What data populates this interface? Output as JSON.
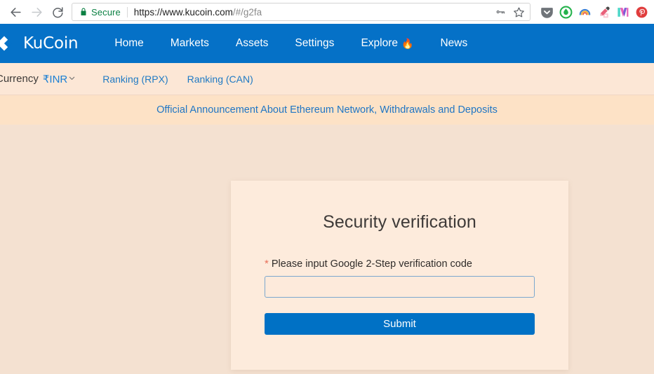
{
  "browser": {
    "back_icon": "back-arrow-icon",
    "forward_icon": "forward-arrow-icon",
    "reload_icon": "reload-icon",
    "security_label": "Secure",
    "url_scheme": "https://",
    "url_main": "www.kucoin.com",
    "url_path": "/#/g2fa",
    "url_full": "https://www.kucoin.com/#/g2fa",
    "omnibox_actions": [
      "key-icon",
      "star-bookmark-icon"
    ],
    "extensions": [
      {
        "name": "pocket-extension",
        "glyph": ""
      },
      {
        "name": "green-circle-extension",
        "glyph": ""
      },
      {
        "name": "rainbow-arc-extension",
        "glyph": ""
      },
      {
        "name": "eyedropper-extension",
        "glyph": ""
      },
      {
        "name": "w-logo-extension",
        "glyph": ""
      },
      {
        "name": "pinterest-extension",
        "glyph": "P"
      }
    ]
  },
  "site": {
    "brand": "KuCoin",
    "nav": [
      {
        "label": "Home"
      },
      {
        "label": "Markets"
      },
      {
        "label": "Assets"
      },
      {
        "label": "Settings"
      },
      {
        "label": "Explore",
        "badge": "🔥"
      },
      {
        "label": "News"
      }
    ],
    "subbar": {
      "currency_label": "Currency",
      "currency_value": "₹INR",
      "chevron": "⌄",
      "links": [
        {
          "label": "Ranking (RPX)"
        },
        {
          "label": "Ranking (CAN)"
        }
      ]
    },
    "announcement": "Official Announcement About Ethereum Network, Withdrawals and Deposits"
  },
  "card": {
    "title": "Security verification",
    "required_marker": "*",
    "field_label": "Please input Google 2-Step verification code",
    "input_value": "",
    "input_placeholder": "",
    "submit_label": "Submit"
  },
  "colors": {
    "brand_blue": "#0571c7",
    "button_blue": "#0071c5",
    "link_blue": "#2076c4",
    "page_bg": "#f4e1d1",
    "card_bg": "#fdebdc",
    "announce_bg": "#fde2c6",
    "subbar_bg": "#fce7d6",
    "secure_green": "#0b8043",
    "required_red": "#e8705a"
  }
}
